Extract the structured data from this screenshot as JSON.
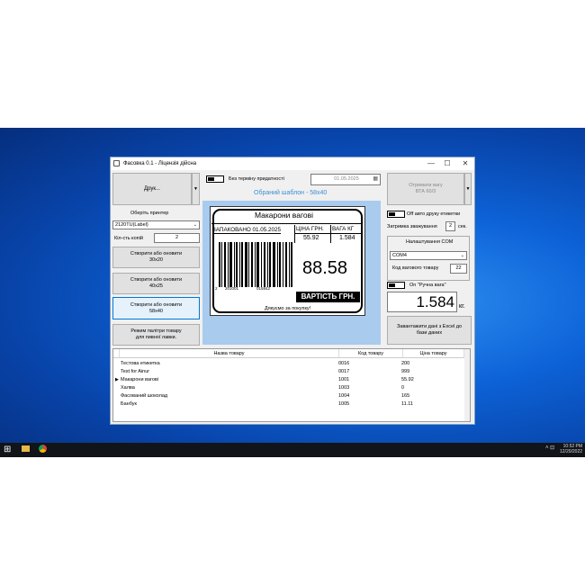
{
  "window": {
    "title": "Фасовка 0.1 - Ліцензія дійсна",
    "minimize": "—",
    "maximize": "☐",
    "close": "✕"
  },
  "left": {
    "print_btn": "Друк...",
    "print_arrow": "▼",
    "printer_label": "Оберіть принтер",
    "printer_value": "2120TU(Label)",
    "copies_label": "Кіл-сть копій",
    "copies_value": "2",
    "btn_30": "Створити або оновити\n30x20",
    "btn_40": "Створити або оновити\n40x25",
    "btn_58": "Створити або оновити\n58x40",
    "btn_beer": "Режим палітри товару\nдля пивної лавки."
  },
  "center": {
    "no_expiry_label": "Без терміну придатності",
    "date_value": "01.05.2025",
    "template_label": "Обраний шаблон - 58x40"
  },
  "label": {
    "title": "Макарони вагові",
    "packed": "ЗАПАКОВАНО 01.05.2025",
    "price_header": "ЦІНА ГРН.",
    "weight_header": "ВАГА КГ",
    "price": "55.92",
    "weight": "1.584",
    "total": "88.58",
    "total_label": "ВАРТІСТЬ ГРН.",
    "barcode_digits": [
      "2",
      "201001",
      "015842"
    ],
    "thanks": "Дякуємо за покупку!"
  },
  "right": {
    "get_weight_btn": "Отримати вагу\nВТА 60/3",
    "auto_print_label": "Off авто друку етикетки",
    "delay_label": "Затримка зважування",
    "delay_value": "2",
    "delay_unit": "сек.",
    "com_settings": "Налаштування COM",
    "com_value": "COM4",
    "weight_code_label": "Код вагового товару",
    "weight_code_value": "22",
    "manual_weight_label": "On \"Ручна вага\"",
    "weight_display": "1.584",
    "weight_unit": "кг.",
    "excel_btn": "Завантажити дані з Excel до бази даних"
  },
  "grid": {
    "headers": [
      "Назва товару",
      "Код товару",
      "Ціна товару"
    ],
    "rows": [
      [
        "Тестова етикетка",
        "0016",
        "200"
      ],
      [
        "Test for Ainur",
        "0017",
        "999"
      ],
      [
        "Макарони вагові",
        "1001",
        "55.92"
      ],
      [
        "Халва",
        "1003",
        "0"
      ],
      [
        "Фасований шоколад",
        "1004",
        "165"
      ],
      [
        "Банбук",
        "1005",
        "11.11"
      ]
    ],
    "selected_row": 2
  },
  "taskbar": {
    "start": "⊞",
    "time": "10:52 PM",
    "date": "12/20/2022"
  }
}
